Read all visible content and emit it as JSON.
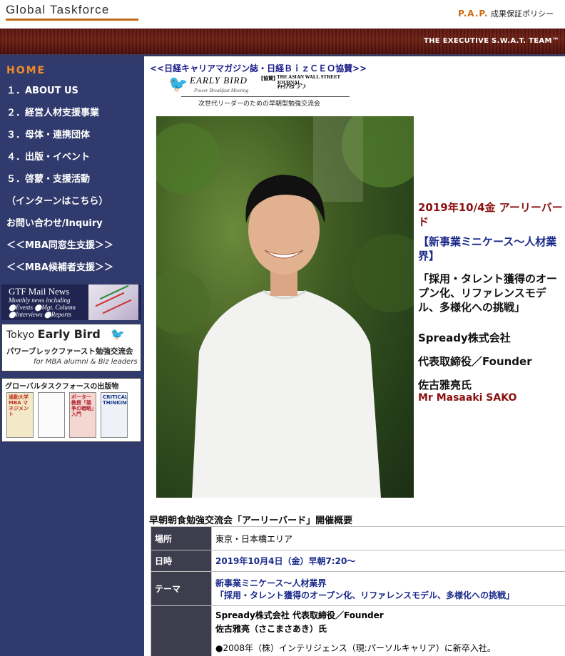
{
  "header": {
    "logo": "Global Taskforce",
    "pap_mark": "P.A.P.",
    "pap_label": "成果保証ポリシー",
    "tagline": "THE EXECUTIVE S.W.A.T. TEAM™"
  },
  "sidebar": {
    "home": "HOME",
    "items": [
      {
        "label": "１．ABOUT US"
      },
      {
        "label": "２．経営人材支援事業"
      },
      {
        "label": "３．母体・連携団体"
      },
      {
        "label": "４．出版・イベント"
      },
      {
        "label": "５．啓蒙・支援活動"
      },
      {
        "label": "（インターンはこちら）"
      },
      {
        "label": "お問い合わせ/Inquiry"
      },
      {
        "label": "＜＜MBA同窓生支援＞＞"
      },
      {
        "label": "＜＜MBA候補者支援＞＞"
      }
    ],
    "mail_news": {
      "title": "GTF Mail News",
      "line1": "Monthly news including",
      "line2": "⬤Events ⬤Mgt. Column",
      "line3": "⬤Interviews ⬤Reports"
    },
    "early_bird": {
      "title_prefix": "Tokyo ",
      "title_bold": "Early Bird",
      "subtitle": "パワーブレックファースト勉強交流会",
      "tagline": "for MBA alumni & Biz leaders"
    },
    "publications": {
      "title": "グローバルタスクフォースの出版物",
      "books": [
        "通勤大学MBA マネジメント",
        "ポーター教授「競争の戦略」入門",
        "CRITICAL THINKING"
      ]
    }
  },
  "main": {
    "cobrand": "<<日経キャリアマガジン誌・日経ＢｉｚＣＥＯ協賛>>",
    "eb_logo": {
      "title": "EARLY BIRD",
      "subtitle": "Power Breakfast Meeting",
      "kyosan": "【協賛】",
      "wsj": "THE ASIAN WALL STREET JOURNAL",
      "career_mag": "ｷｬﾘｱﾏｶﾞｼﾞﾝ",
      "tagline": "次世代リーダーのための早朝型勉強交流会"
    },
    "event": {
      "date": "2019年10/4金 アーリーバード",
      "subtitle": "【新事業ミニケース～人材業界】",
      "theme": "「採用・タレント獲得のオープン化、リファレンスモデル、多様化への挑戦」",
      "company": "Spready株式会社",
      "role": "代表取締役／Founder",
      "speaker": "佐古雅亮氏",
      "speaker_en": "Mr Masaaki SAKO"
    },
    "overview_title": "早朝朝食勉強交流会「アーリーバード」開催概要",
    "table": {
      "place_label": "場所",
      "place": "東京・日本橋エリア",
      "datetime_label": "日時",
      "datetime": "2019年10月4日（金）早朝7:20～",
      "theme_label": "テーマ",
      "theme_line1": "新事業ミニケース～人材業界",
      "theme_line2": "「採用・タレント獲得のオープン化、リファレンスモデル、多様化への挑戦」",
      "speaker_line1": "Spready株式会社 代表取締役／Founder",
      "speaker_line2": "佐古雅亮（さこまさあき）氏",
      "bio1": "●2008年（株）インテリジェンス（現:パーソルキャリア）に新卒入社。"
    }
  }
}
